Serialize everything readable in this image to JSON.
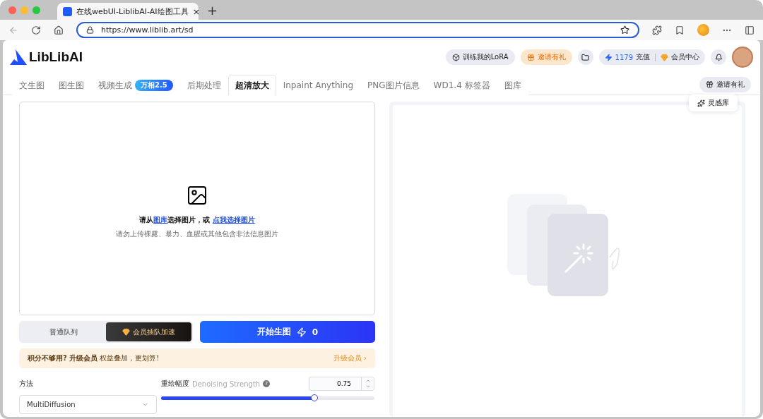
{
  "browser": {
    "tab_title": "在线webUI-LiblibAI-AI绘图工具",
    "tab_close": "×",
    "new_tab": "+",
    "url": "https://www.liblib.art/sd"
  },
  "header": {
    "logo": "LibLibAI",
    "train_button": "训练我的LoRA",
    "invite_button": "邀请有礼",
    "credits": "1179",
    "recharge": "充值",
    "member": "会员中心"
  },
  "tabs": [
    {
      "label": "文生图",
      "selected": false
    },
    {
      "label": "图生图",
      "selected": false
    },
    {
      "label": "视频生成",
      "selected": false,
      "badge": "万相2.5"
    },
    {
      "label": "后期处理",
      "selected": false
    },
    {
      "label": "超清放大",
      "selected": true
    },
    {
      "label": "Inpaint Anything",
      "selected": false
    },
    {
      "label": "PNG图片信息",
      "selected": false
    },
    {
      "label": "WD1.4 标签器",
      "selected": false
    },
    {
      "label": "图库",
      "selected": false
    }
  ],
  "tab_actions": {
    "invite": "邀请有礼",
    "inspiration": "灵感库"
  },
  "upload": {
    "prefix": "请从",
    "gallery_link": "图库",
    "middle": "选择图片，或",
    "pick_link": "点我选择图片",
    "warning": "请勿上传裸露、暴力、血腥或其他包含非法信息图片"
  },
  "queue": [
    {
      "label": "普通队列",
      "selected": false
    },
    {
      "label": "会员插队加速",
      "selected": true
    }
  ],
  "generate": {
    "label": "开始生图",
    "cost": "0"
  },
  "promo": {
    "text": "**积分不够用? 升级会员** 权益叠加，更划算!",
    "link": "升级会员 ›"
  },
  "method": {
    "label": "方法",
    "value": "MultiDiffusion"
  },
  "denoise": {
    "label": "重绘幅度",
    "hint": "Denoising Strength",
    "help": "?",
    "value": "0.75",
    "level": 0.72
  }
}
